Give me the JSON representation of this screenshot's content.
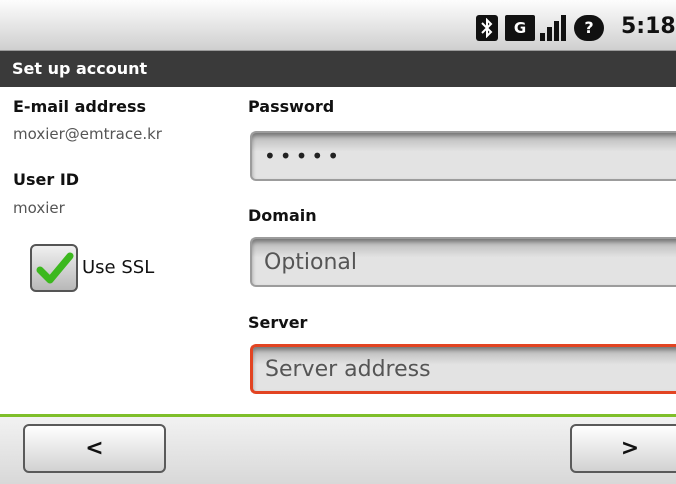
{
  "status_bar": {
    "time": "5:18",
    "network_badge": "G",
    "alarm_badge": "?",
    "icons": [
      "bluetooth-icon",
      "gsm-data-icon",
      "signal-strength-icon",
      "alarm-icon"
    ]
  },
  "title_bar": {
    "title": "Set up account"
  },
  "account_info": {
    "email_label": "E-mail address",
    "email_value": "moxier@emtrace.kr",
    "userid_label": "User ID",
    "userid_value": "moxier"
  },
  "ssl": {
    "label": "Use SSL",
    "checked": true,
    "check_color": "#3cb81e"
  },
  "fields": {
    "password_label": "Password",
    "password_value": "•••••",
    "domain_label": "Domain",
    "domain_placeholder": "Optional",
    "server_label": "Server",
    "server_placeholder": "Server address",
    "error_border_color": "#e24422"
  },
  "nav": {
    "prev_label": "<",
    "next_label": ">"
  },
  "colors": {
    "title_bar": "#3a3a3a",
    "separator": "#7fbf2a"
  }
}
